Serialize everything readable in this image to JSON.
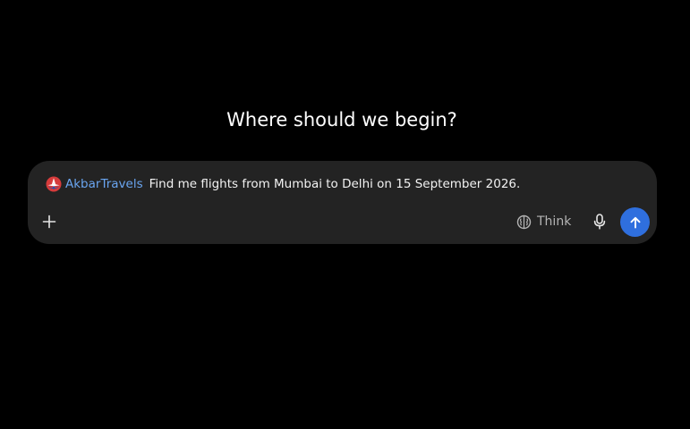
{
  "heading": "Where should we begin?",
  "composer": {
    "app": {
      "name": "AkbarTravels",
      "logo_icon": "akbar-travels-logo"
    },
    "prompt_text": "Find me flights from Mumbai to Delhi on 15 September 2026.",
    "think_label": "Think",
    "icons": {
      "add": "plus-icon",
      "think": "brain-icon",
      "mic": "microphone-icon",
      "send": "arrow-up-icon"
    }
  },
  "colors": {
    "background": "#000000",
    "composer_bg": "#232323",
    "app_name": "#6aa5f0",
    "send_button": "#2f6fde",
    "muted_text": "#b4b4b4"
  }
}
